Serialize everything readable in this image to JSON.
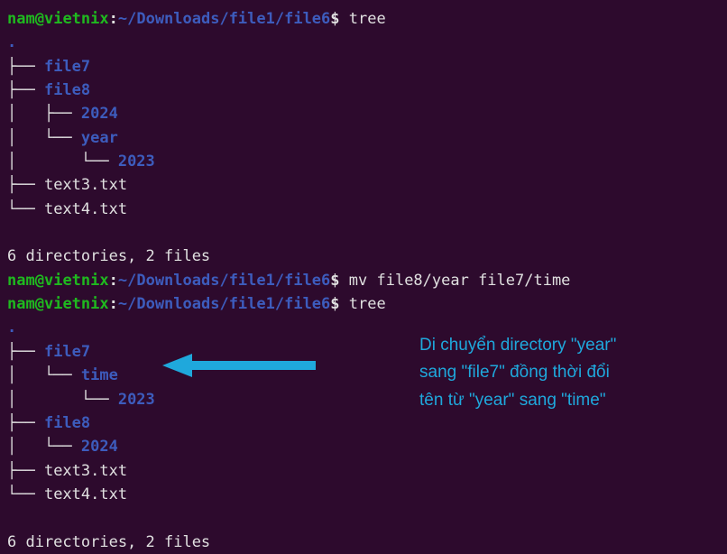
{
  "prompt": {
    "user": "nam",
    "at": "@",
    "host": "vietnix",
    "colon": ":",
    "path": "~/Downloads/file1/file6",
    "dollar": "$"
  },
  "cmd1": "tree",
  "cmd2": "mv file8/year file7/time",
  "cmd3": "tree",
  "tree1": {
    "root": ".",
    "l0": "├── ",
    "l1": "├── ",
    "l2": "│   ├── ",
    "l3": "│   └── ",
    "l4": "│       └── ",
    "l5": "├── ",
    "l6": "└── ",
    "file7": "file7",
    "file8": "file8",
    "d2024": "2024",
    "year": "year",
    "d2023": "2023",
    "text3": "text3.txt",
    "text4": "text4.txt"
  },
  "summary1": "6 directories, 2 files",
  "tree2": {
    "root": ".",
    "l0": "├── ",
    "l1": "│   └── ",
    "l2": "│       └── ",
    "l3": "├── ",
    "l4": "│   └── ",
    "l5": "├── ",
    "l6": "└── ",
    "file7": "file7",
    "time": "time",
    "d2023": "2023",
    "file8": "file8",
    "d2024": "2024",
    "text3": "text3.txt",
    "text4": "text4.txt"
  },
  "summary2": "6 directories, 2 files",
  "annotation": {
    "line1": "Di chuyển directory \"year\"",
    "line2": "sang \"file7\" đồng thời đổi",
    "line3": "tên từ \"year\" sang \"time\""
  }
}
